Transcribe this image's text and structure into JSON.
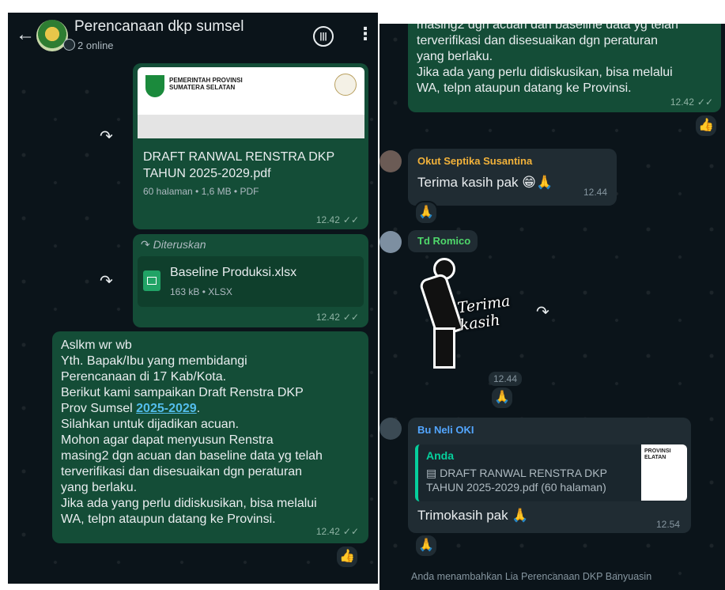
{
  "header": {
    "title": "Perencanaan dkp sumsel",
    "subtitle": "2 online"
  },
  "left": {
    "doc": {
      "heading": "PEMERINTAH PROVINSI\nSUMATERA SELATAN",
      "name": "DRAFT RANWAL RENSTRA DKP TAHUN 2025-2029.pdf",
      "meta": "60 halaman • 1,6 MB • PDF",
      "time": "12.42"
    },
    "xlsx": {
      "forward_label": "Diteruskan",
      "name": "Baseline Produksi.xlsx",
      "meta": "163 kB • XLSX",
      "time": "12.42"
    },
    "message": {
      "text_before": "Aslkm wr wb\nYth. Bapak/Ibu yang membidangi\nPerencanaan di 17 Kab/Kota.\nBerikut kami sampaikan Draft Renstra DKP\nProv Sumsel ",
      "link": "2025-2029",
      "text_after": ".\nSilahkan untuk dijadikan acuan.\nMohon agar dapat menyusun Renstra\nmasing2 dgn acuan dan baseline data yg telah\nterverifikasi dan disesuaikan dgn peraturan\nyang berlaku.\nJika ada yang perlu didiskusikan, bisa melalui\nWA, telpn ataupun datang ke Provinsi.",
      "time": "12.42",
      "reaction": "👍"
    }
  },
  "right": {
    "top_message": {
      "text": "masing2 dgn acuan dan baseline data yg telah\nterverifikasi dan disesuaikan dgn peraturan\nyang berlaku.\nJika ada yang perlu didiskusikan, bisa melalui\nWA, telpn ataupun datang ke Provinsi.",
      "time": "12.42",
      "reaction": "👍"
    },
    "okut": {
      "sender": "Okut Septika Susantina",
      "text": "Terima kasih pak 😁🙏",
      "time": "12.44",
      "reaction": "🙏"
    },
    "romico": {
      "sender": "Td Romico",
      "sticker_text": "Terima\nkasih",
      "time": "12.44",
      "reaction": "🙏"
    },
    "neli": {
      "sender": "Bu Neli OKI",
      "quote_author": "Anda",
      "quote_text": "▤ DRAFT RANWAL RENSTRA DKP TAHUN 2025-2029.pdf (60 halaman)",
      "quote_thumb": "PROVINSI\nELATAN",
      "text": "Trimokasih pak 🙏",
      "time": "12.54",
      "reaction": "🙏"
    },
    "system": "Anda menambahkan Lia Perencanaan DKP Banyuasin"
  },
  "colors": {
    "bg": "#0b141a",
    "outgoing": "#144d37",
    "incoming": "#202c33",
    "link": "#53bdeb",
    "name_okut": "#f2b23a",
    "name_romico": "#4fd86b",
    "name_neli": "#53a6ff"
  }
}
